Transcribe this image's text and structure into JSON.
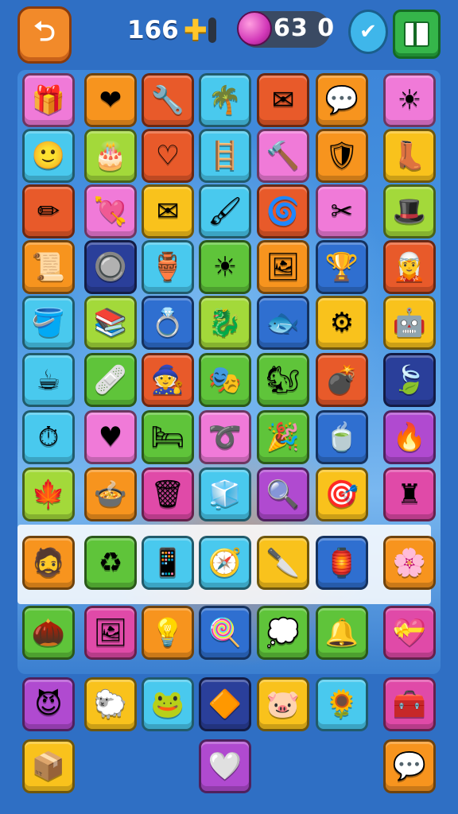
{
  "header": {
    "back_icon": "back-arrow-icon",
    "score_value": "166",
    "gem_count": "63 0",
    "check_icon": "checkmark-icon",
    "menu_icon": "grid-menu-icon"
  },
  "colors": {
    "background": "#2f6fc4",
    "pink": "#f07ad8",
    "orange": "#f7941e",
    "red": "#e85a2a",
    "cyan": "#49c9ee",
    "yellow": "#f9c21c",
    "green": "#5fc43a",
    "lime": "#a3d93a",
    "blue": "#2f6fd0",
    "navy": "#2a3f9a",
    "purple": "#b04ad0",
    "magenta": "#e04aa8",
    "teal": "#2dbab0"
  },
  "board": {
    "rows": [
      [
        {
          "name": "treasure-chest-icon",
          "color": "pink",
          "glyph": "🎁"
        },
        {
          "name": "heart-icon",
          "color": "orange",
          "glyph": "❤"
        },
        {
          "name": "hairdryer-icon",
          "color": "red",
          "glyph": "🔧"
        },
        {
          "name": "palm-icon",
          "color": "cyan",
          "glyph": "🌴"
        },
        {
          "name": "card-icon",
          "color": "red",
          "glyph": "✉"
        },
        {
          "name": "speech-bubble-icon",
          "color": "orange",
          "glyph": "💬"
        },
        {
          "name": "sun-badge-icon",
          "color": "pink",
          "glyph": "☀"
        }
      ],
      [
        {
          "name": "elf-face-icon",
          "color": "cyan",
          "glyph": "🙂"
        },
        {
          "name": "cake-icon",
          "color": "lime",
          "glyph": "🎂"
        },
        {
          "name": "heart-swirl-icon",
          "color": "red",
          "glyph": "♡"
        },
        {
          "name": "ladder-icon",
          "color": "cyan",
          "glyph": "🪜"
        },
        {
          "name": "tools-icon",
          "color": "pink",
          "glyph": "🔨"
        },
        {
          "name": "shield-icon",
          "color": "orange",
          "glyph": "🛡"
        },
        {
          "name": "boot-icon",
          "color": "yellow",
          "glyph": "👢"
        }
      ],
      [
        {
          "name": "pencil-icon",
          "color": "red",
          "glyph": "✏"
        },
        {
          "name": "heart-arrow-icon",
          "color": "pink",
          "glyph": "💘"
        },
        {
          "name": "envelope-icon",
          "color": "yellow",
          "glyph": "✉"
        },
        {
          "name": "paintbrush-icon",
          "color": "cyan",
          "glyph": "🖌"
        },
        {
          "name": "spiral-icon",
          "color": "red",
          "glyph": "🌀"
        },
        {
          "name": "scissors-icon",
          "color": "pink",
          "glyph": "✂"
        },
        {
          "name": "witch-hat-icon",
          "color": "lime",
          "glyph": "🎩"
        }
      ],
      [
        {
          "name": "papers-icon",
          "color": "orange",
          "glyph": "📜"
        },
        {
          "name": "shield-ring-icon",
          "color": "navy",
          "glyph": "🔘"
        },
        {
          "name": "jar-icon",
          "color": "cyan",
          "glyph": "🏺"
        },
        {
          "name": "sun-icon",
          "color": "green",
          "glyph": "☀"
        },
        {
          "name": "frame-icon",
          "color": "orange",
          "glyph": "🖼"
        },
        {
          "name": "goblet-icon",
          "color": "blue",
          "glyph": "🏆"
        },
        {
          "name": "gnome-face-icon",
          "color": "red",
          "glyph": "🧝"
        }
      ],
      [
        {
          "name": "bucket-icon",
          "color": "cyan",
          "glyph": "🪣"
        },
        {
          "name": "book-icon",
          "color": "lime",
          "glyph": "📚"
        },
        {
          "name": "ring-icon",
          "color": "blue",
          "glyph": "💍"
        },
        {
          "name": "dragon-icon",
          "color": "lime",
          "glyph": "🐉"
        },
        {
          "name": "fish-icon",
          "color": "blue",
          "glyph": "🐟"
        },
        {
          "name": "gear-icon",
          "color": "yellow",
          "glyph": "⚙"
        },
        {
          "name": "robot-icon",
          "color": "yellow",
          "glyph": "🤖"
        }
      ],
      [
        {
          "name": "mug-icon",
          "color": "cyan",
          "glyph": "☕"
        },
        {
          "name": "bandage-icon",
          "color": "green",
          "glyph": "🩹"
        },
        {
          "name": "gnome-icon",
          "color": "red",
          "glyph": "🧙"
        },
        {
          "name": "mask-icon",
          "color": "green",
          "glyph": "🎭"
        },
        {
          "name": "squirrel-icon",
          "color": "green",
          "glyph": "🐿"
        },
        {
          "name": "bomb-icon",
          "color": "red",
          "glyph": "💣"
        },
        {
          "name": "leaf-icon",
          "color": "navy",
          "glyph": "🍃"
        }
      ],
      [
        {
          "name": "stopwatch-icon",
          "color": "cyan",
          "glyph": "⏱"
        },
        {
          "name": "heart-red-icon",
          "color": "pink",
          "glyph": "♥"
        },
        {
          "name": "bed-icon",
          "color": "green",
          "glyph": "🛏"
        },
        {
          "name": "rope-icon",
          "color": "pink",
          "glyph": "➰"
        },
        {
          "name": "party-hat-icon",
          "color": "green",
          "glyph": "🎉"
        },
        {
          "name": "cup-icon",
          "color": "blue",
          "glyph": "🍵"
        },
        {
          "name": "fire-bowl-icon",
          "color": "purple",
          "glyph": "🔥"
        }
      ],
      [
        {
          "name": "flame-leaf-icon",
          "color": "lime",
          "glyph": "🍁"
        },
        {
          "name": "pot-icon",
          "color": "orange",
          "glyph": "🍲"
        },
        {
          "name": "trash-icon",
          "color": "magenta",
          "glyph": "🗑"
        },
        {
          "name": "cube-icon",
          "color": "cyan",
          "glyph": "🧊"
        },
        {
          "name": "magnifier-icon",
          "color": "purple",
          "glyph": "🔍"
        },
        {
          "name": "target-icon",
          "color": "yellow",
          "glyph": "🎯"
        },
        {
          "name": "chess-rook-icon",
          "color": "magenta",
          "glyph": "♜"
        }
      ],
      [
        {
          "name": "viking-face-icon",
          "color": "orange",
          "glyph": "🧔"
        },
        {
          "name": "recycle-bin-icon",
          "color": "green",
          "glyph": "♻"
        },
        {
          "name": "phone-icon",
          "color": "cyan",
          "glyph": "📱"
        },
        {
          "name": "compass-icon",
          "color": "cyan",
          "glyph": "🧭"
        },
        {
          "name": "knife-icon",
          "color": "yellow",
          "glyph": "🔪"
        },
        {
          "name": "lantern-icon",
          "color": "blue",
          "glyph": "🏮"
        },
        {
          "name": "flower-badge-icon",
          "color": "orange",
          "glyph": "🌸"
        }
      ],
      [
        {
          "name": "acorn-icon",
          "color": "green",
          "glyph": "🌰"
        },
        {
          "name": "easel-icon",
          "color": "magenta",
          "glyph": "🖼"
        },
        {
          "name": "lamp-icon",
          "color": "orange",
          "glyph": "💡"
        },
        {
          "name": "lollipop-icon",
          "color": "blue",
          "glyph": "🍭"
        },
        {
          "name": "chat-bubble-icon",
          "color": "green",
          "glyph": "💭"
        },
        {
          "name": "bell-creature-icon",
          "color": "green",
          "glyph": "🔔"
        },
        {
          "name": "heart-wreath-icon",
          "color": "magenta",
          "glyph": "💝"
        }
      ],
      [
        {
          "name": "devil-face-icon",
          "color": "purple",
          "glyph": "😈"
        },
        {
          "name": "sheep-icon",
          "color": "yellow",
          "glyph": "🐑"
        },
        {
          "name": "frog-icon",
          "color": "cyan",
          "glyph": "🐸"
        },
        {
          "name": "kite-icon",
          "color": "navy",
          "glyph": "🔶"
        },
        {
          "name": "pig-face-icon",
          "color": "yellow",
          "glyph": "🐷"
        },
        {
          "name": "sunflower-icon",
          "color": "cyan",
          "glyph": "🌻"
        },
        {
          "name": "chest-icon",
          "color": "magenta",
          "glyph": "🧰"
        }
      ]
    ],
    "bottom_row": [
      {
        "name": "box-icon",
        "color": "yellow",
        "glyph": "📦"
      },
      {
        "name": "heart-white-icon",
        "color": "purple",
        "glyph": "🤍"
      },
      {
        "name": "bubble-icon",
        "color": "orange",
        "glyph": "💬"
      }
    ]
  }
}
